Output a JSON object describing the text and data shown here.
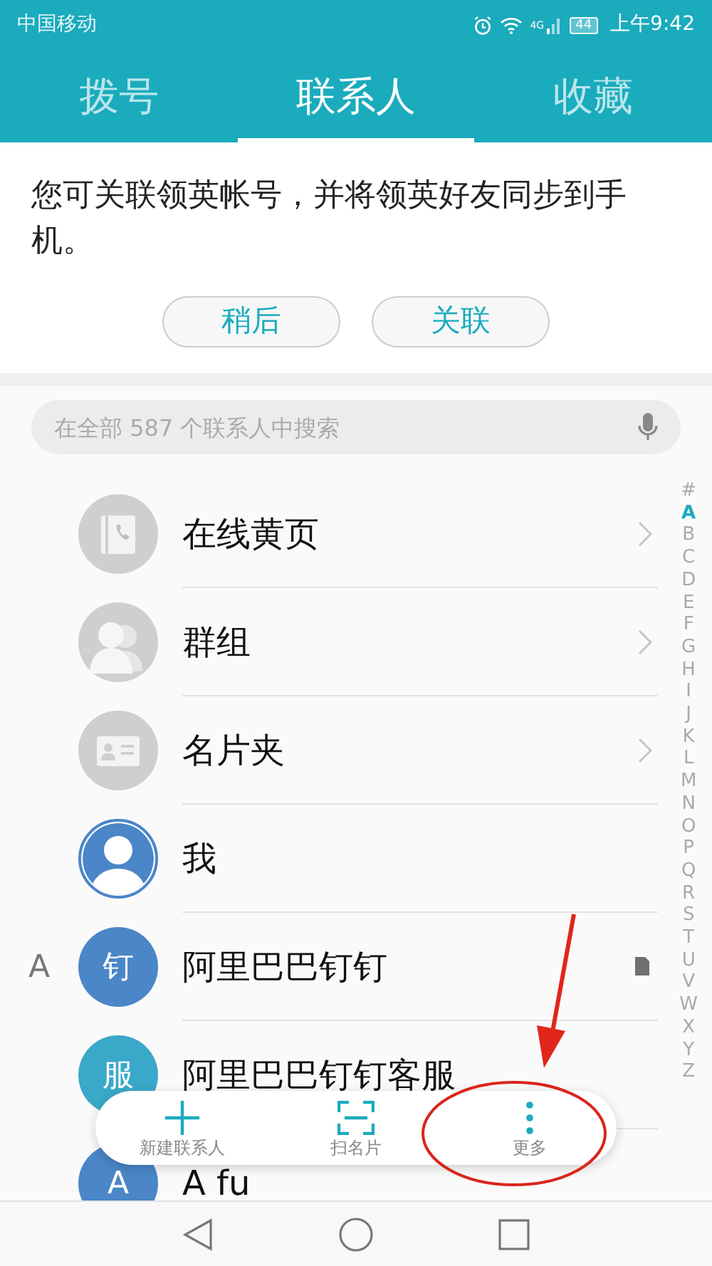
{
  "status_bar": {
    "carrier": "中国移动",
    "network": "4G",
    "battery": "44",
    "time": "上午9:42"
  },
  "tabs": [
    {
      "label": "拨号",
      "selected": false
    },
    {
      "label": "联系人",
      "selected": true
    },
    {
      "label": "收藏",
      "selected": false
    }
  ],
  "banner": {
    "text": "您可关联领英帐号，并将领英好友同步到手机。",
    "buttons": [
      "稍后",
      "关联"
    ]
  },
  "search": {
    "placeholder": "在全部 587 个联系人中搜索"
  },
  "rows": [
    {
      "kind": "yellow_pages",
      "name": "在线黄页",
      "chevron": true
    },
    {
      "kind": "groups",
      "name": "群组",
      "chevron": true
    },
    {
      "kind": "cards",
      "name": "名片夹",
      "chevron": true
    },
    {
      "kind": "me",
      "name": "我",
      "color": "#4a86c8"
    },
    {
      "kind": "contact",
      "section": "A",
      "avatar": "钉",
      "name": "阿里巴巴钉钉",
      "color": "#4a86c8",
      "note": true
    },
    {
      "kind": "contact",
      "avatar": "服",
      "name": "阿里巴巴钉钉客服",
      "color": "#3aa8c9"
    },
    {
      "kind": "contact",
      "avatar": "A",
      "name": "A fu",
      "color": "#4a86c8"
    }
  ],
  "index": [
    {
      "label": "#",
      "selected": false
    },
    {
      "label": "A",
      "selected": true
    },
    {
      "label": "B",
      "selected": false
    },
    {
      "label": "C",
      "selected": false
    },
    {
      "label": "D",
      "selected": false
    },
    {
      "label": "E",
      "selected": false
    },
    {
      "label": "F",
      "selected": false
    },
    {
      "label": "G",
      "selected": false
    },
    {
      "label": "H",
      "selected": false
    },
    {
      "label": "I",
      "selected": false
    },
    {
      "label": "J",
      "selected": false
    },
    {
      "label": "K",
      "selected": false
    },
    {
      "label": "L",
      "selected": false
    },
    {
      "label": "M",
      "selected": false
    },
    {
      "label": "N",
      "selected": false
    },
    {
      "label": "O",
      "selected": false
    },
    {
      "label": "P",
      "selected": false
    },
    {
      "label": "Q",
      "selected": false
    },
    {
      "label": "R",
      "selected": false
    },
    {
      "label": "S",
      "selected": false
    },
    {
      "label": "T",
      "selected": false
    },
    {
      "label": "U",
      "selected": false
    },
    {
      "label": "V",
      "selected": false
    },
    {
      "label": "W",
      "selected": false
    },
    {
      "label": "X",
      "selected": false
    },
    {
      "label": "Y",
      "selected": false
    },
    {
      "label": "Z",
      "selected": false
    }
  ],
  "toolbar": [
    {
      "kind": "add",
      "label": "新建联系人"
    },
    {
      "kind": "scan",
      "label": "扫名片"
    },
    {
      "kind": "more",
      "label": "更多"
    }
  ]
}
